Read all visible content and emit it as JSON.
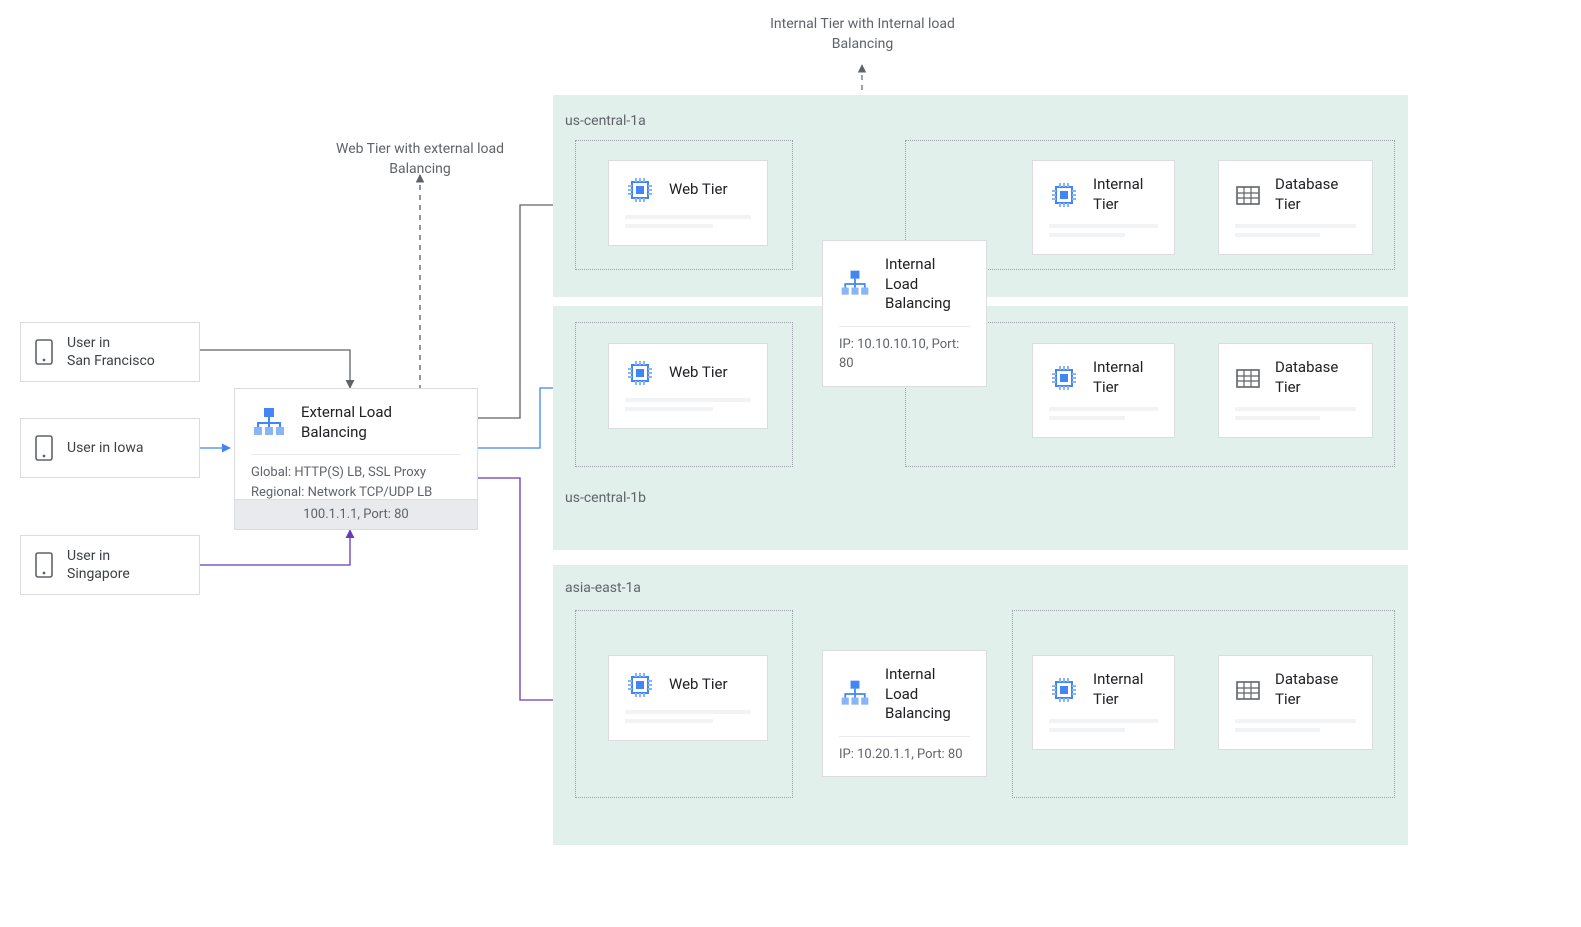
{
  "annotations": {
    "web_tier": "Web Tier with external load\nBalancing",
    "internal_tier": "Internal Tier with Internal load\nBalancing"
  },
  "users": {
    "sf": "User in\nSan Francisco",
    "iowa": "User in Iowa",
    "singapore": "User in\nSingapore"
  },
  "external_lb": {
    "title": "External Load\nBalancing",
    "line1": "Global: HTTP(S) LB, SSL Proxy",
    "line2": "Regional: Network TCP/UDP LB",
    "footer": "100.1.1.1, Port: 80"
  },
  "regions": {
    "us_central_1a": "us-central-1a",
    "us_central_1b": "us-central-1b",
    "asia_east_1a": "asia-east-1a"
  },
  "nodes": {
    "web_tier": "Web Tier",
    "internal_tier": "Internal\nTier",
    "database_tier": "Database\nTier",
    "internal_lb": "Internal Load\nBalancing"
  },
  "ilb": {
    "us": "IP: 10.10.10.10, Port: 80",
    "asia": "IP: 10.20.1.1, Port: 80"
  }
}
